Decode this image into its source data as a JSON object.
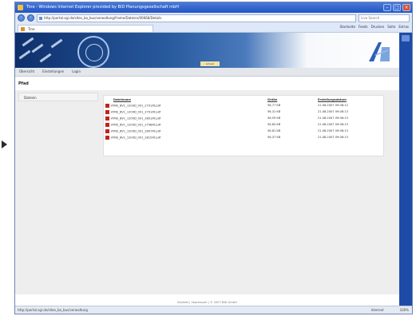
{
  "window": {
    "title": "Tine - Windows Internet Explorer provided by BID Planungsgesellschaft mbH"
  },
  "addressbar": {
    "url": "http://portal.sgi.de/sites_ba_bus/verwaltung/frame/Dateien/00668/Details",
    "search_placeholder": "Live Search"
  },
  "tab": {
    "label": "Tine"
  },
  "toolbar": {
    "items": [
      "Startseite",
      "Feeds",
      "Drucken",
      "Seite",
      "Extras"
    ]
  },
  "banner": {
    "note": "Aktuell"
  },
  "menubar": {
    "items": [
      "Übersicht",
      "Einstellungen",
      "Login"
    ]
  },
  "page": {
    "label": "Pfad"
  },
  "sidebar": {
    "item": "Dateien"
  },
  "files": {
    "headers": [
      "Dateiname",
      "Größe",
      "Erstellungsdatum"
    ],
    "rows": [
      {
        "name": "ATRE_BV1_1200D_001_2791AT.pdf",
        "size": "56,77 KB",
        "date": "21.08.2007 09:08:12"
      },
      {
        "name": "ATRE_BV1_1200D_001_2791AT.pdf",
        "size": "56,31 KB",
        "date": "21.08.2007 09:08:13"
      },
      {
        "name": "ATRE_BV1_1200D_001_2801AT.pdf",
        "size": "56,59 KB",
        "date": "21.08.2007 09:08:13"
      },
      {
        "name": "ATRE_BV1_1200D_001_2798AT.pdf",
        "size": "56,63 KB",
        "date": "21.08.2007 09:08:13"
      },
      {
        "name": "ATRE_BV1_1200D_001_2807AT.pdf",
        "size": "56,81 KB",
        "date": "21.08.2007 09:08:13"
      },
      {
        "name": "ATRE_BV1_1200D_001_2815AT.pdf",
        "size": "56,37 KB",
        "date": "21.08.2007 09:08:13"
      }
    ]
  },
  "footer": {
    "text": "Kontakt | Impressum | © 2007 BID GmbH"
  },
  "statusbar": {
    "url": "http://portal.sgi.de/sites_ba_bus/verwaltung",
    "zone": "Internet",
    "zoom": "100%"
  }
}
